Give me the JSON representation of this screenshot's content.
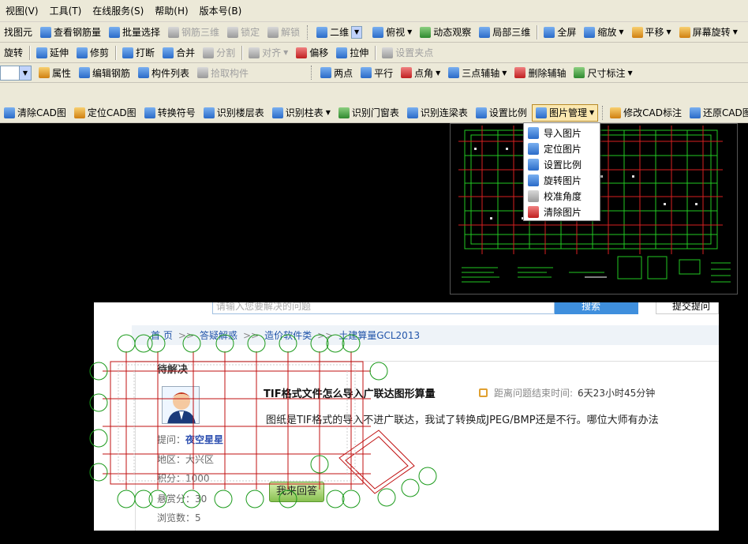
{
  "menubar": [
    {
      "label": "视图(V)"
    },
    {
      "label": "工具(T)"
    },
    {
      "label": "在线服务(S)"
    },
    {
      "label": "帮助(H)"
    },
    {
      "label": "版本号(B)"
    }
  ],
  "toolbar1": {
    "find_element": "找图元",
    "view_rebar": "查看钢筋量",
    "batch_select": "批量选择",
    "rebar_3d": "钢筋三维",
    "lock": "锁定",
    "unlock": "解锁",
    "view_2d": "二维",
    "top_view": "俯视",
    "dynamic_observe": "动态观察",
    "local_3d": "局部三维",
    "fullscreen": "全屏",
    "zoom": "缩放",
    "pan": "平移",
    "screen_rotate": "屏幕旋转"
  },
  "toolbar2": {
    "rotate": "旋转",
    "extend": "延伸",
    "trim": "修剪",
    "break": "打断",
    "merge": "合并",
    "split": "分割",
    "align": "对齐",
    "offset": "偏移",
    "stretch": "拉伸",
    "set_grip": "设置夹点"
  },
  "toolbar3": {
    "properties": "属性",
    "edit_rebar": "编辑钢筋",
    "component_list": "构件列表",
    "pick_component": "拾取构件",
    "two_points": "两点",
    "parallel": "平行",
    "point_angle": "点角",
    "three_point_aux": "三点辅轴",
    "delete_aux": "删除辅轴",
    "dimension": "尺寸标注"
  },
  "toolbar4": {
    "clear_cad": "清除CAD图",
    "locate_cad": "定位CAD图",
    "convert_symbol": "转换符号",
    "recognize_floor": "识别楼层表",
    "recognize_column": "识别柱表",
    "recognize_door_window": "识别门窗表",
    "recognize_beam": "识别连梁表",
    "set_scale": "设置比例",
    "image_manage": "图片管理",
    "modify_cad_label": "修改CAD标注",
    "restore_cad": "还原CAD图元"
  },
  "image_menu": [
    {
      "label": "导入图片",
      "icon": "import-image-icon"
    },
    {
      "label": "定位图片",
      "icon": "locate-image-icon"
    },
    {
      "label": "设置比例",
      "icon": "scale-icon"
    },
    {
      "label": "旋转图片",
      "icon": "rotate-image-icon"
    },
    {
      "label": "校准角度",
      "icon": "calibrate-angle-icon"
    },
    {
      "label": "清除图片",
      "icon": "clear-image-icon"
    }
  ],
  "webpage": {
    "search_placeholder": "请输入您要解决的问题",
    "search_button": "搜索",
    "top_right": "提交提问",
    "breadcrumb": [
      "首 页",
      "答疑解惑",
      "造价软件类",
      "土建算量GCL2013"
    ],
    "waiting_header": "待解决",
    "question_title": "TIF格式文件怎么导入广联达图形算量",
    "timer_label": "距离问题结束时间:",
    "timer_value": "6天23小时45分钟",
    "question_body": "图纸是TIF格式的导入不进广联达，我试了转换成JPEG/BMP还是不行。哪位大师有办法",
    "asker_label": "提问：",
    "asker_name": "夜空星星",
    "region": "地区：大兴区",
    "level": "积分：1000",
    "reward": "悬赏分：30",
    "views": "浏览数：5",
    "answer_button": "我来回答"
  }
}
